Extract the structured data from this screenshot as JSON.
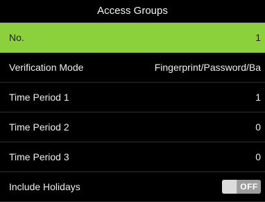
{
  "header": {
    "title": "Access Groups"
  },
  "rows": [
    {
      "label": "No.",
      "value": "1",
      "selected": true
    },
    {
      "label": "Verification Mode",
      "value": "Fingerprint/Password/Ba",
      "selected": false
    },
    {
      "label": "Time Period 1",
      "value": "1",
      "selected": false
    },
    {
      "label": "Time Period 2",
      "value": "0",
      "selected": false
    },
    {
      "label": "Time Period 3",
      "value": "0",
      "selected": false
    },
    {
      "label": "Include Holidays",
      "toggle_state": "OFF",
      "selected": false
    }
  ],
  "colors": {
    "selected_background": "#8bd13b",
    "screen_background": "#000000",
    "text": "#efefef"
  },
  "icons": {
    "toggle": "switch-toggle"
  }
}
